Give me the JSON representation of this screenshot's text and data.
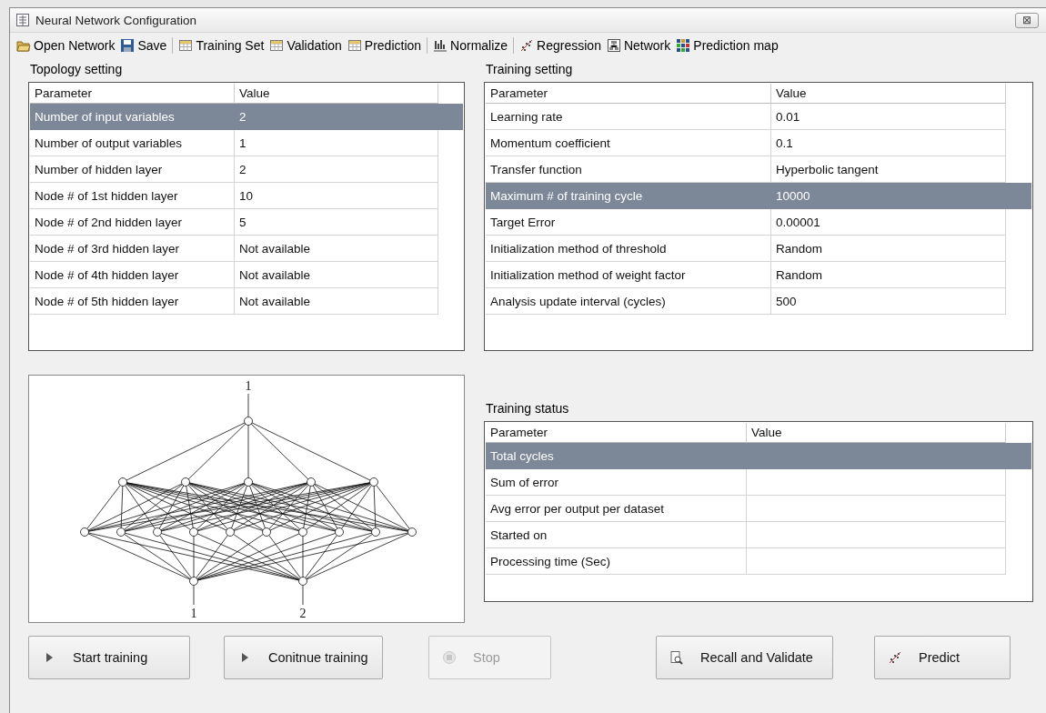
{
  "window": {
    "title": "Neural Network Configuration",
    "close": "⊠"
  },
  "toolbar": {
    "groups": [
      [
        {
          "label": "Open Network",
          "kind": "folder"
        },
        {
          "label": "Save",
          "kind": "disk"
        }
      ],
      [
        {
          "label": "Training Set",
          "kind": "grid"
        },
        {
          "label": "Validation",
          "kind": "grid"
        },
        {
          "label": "Prediction",
          "kind": "grid"
        }
      ],
      [
        {
          "label": "Normalize",
          "kind": "bars"
        }
      ],
      [
        {
          "label": "Regression",
          "kind": "scatter"
        },
        {
          "label": "Network",
          "kind": "network"
        },
        {
          "label": "Prediction map",
          "kind": "tiles"
        }
      ]
    ]
  },
  "topology": {
    "title": "Topology setting",
    "columns": [
      "Parameter",
      "Value"
    ],
    "rows": [
      {
        "cells": [
          "Number of input variables",
          "2"
        ],
        "selected": true
      },
      {
        "cells": [
          "Number of output variables",
          "1"
        ],
        "selected": false
      },
      {
        "cells": [
          "Number of hidden layer",
          "2"
        ],
        "selected": false
      },
      {
        "cells": [
          "Node # of 1st hidden layer",
          "10"
        ],
        "selected": false
      },
      {
        "cells": [
          "Node # of 2nd hidden layer",
          "5"
        ],
        "selected": false
      },
      {
        "cells": [
          "Node # of 3rd hidden layer",
          "Not available"
        ],
        "selected": false
      },
      {
        "cells": [
          "Node # of 4th hidden layer",
          "Not available"
        ],
        "selected": false
      },
      {
        "cells": [
          "Node # of 5th hidden layer",
          "Not available"
        ],
        "selected": false
      }
    ]
  },
  "training": {
    "title": "Training setting",
    "columns": [
      "Parameter",
      "Value"
    ],
    "rows": [
      {
        "cells": [
          "Learning rate",
          "0.01"
        ],
        "selected": false
      },
      {
        "cells": [
          "Momentum coefficient",
          "0.1"
        ],
        "selected": false
      },
      {
        "cells": [
          "Transfer function",
          "Hyperbolic tangent"
        ],
        "selected": false
      },
      {
        "cells": [
          "Maximum # of training cycle",
          "10000"
        ],
        "selected": true
      },
      {
        "cells": [
          "Target Error",
          "0.00001"
        ],
        "selected": false
      },
      {
        "cells": [
          "Initialization method of threshold",
          "Random"
        ],
        "selected": false
      },
      {
        "cells": [
          "Initialization method of weight factor",
          "Random"
        ],
        "selected": false
      },
      {
        "cells": [
          "Analysis update interval (cycles)",
          "500"
        ],
        "selected": false
      }
    ]
  },
  "diagram": {
    "output_labels": [
      "1"
    ],
    "input_labels": [
      "1",
      "2"
    ]
  },
  "status": {
    "title": "Training status",
    "columns": [
      "Parameter",
      "Value"
    ],
    "rows": [
      {
        "cells": [
          "Total cycles"
        ],
        "selected": true
      },
      {
        "cells": [
          "Sum of error"
        ],
        "selected": false
      },
      {
        "cells": [
          "Avg error per output per dataset"
        ],
        "selected": false
      },
      {
        "cells": [
          "Started on"
        ],
        "selected": false
      },
      {
        "cells": [
          "Processing time (Sec)"
        ],
        "selected": false
      }
    ]
  },
  "buttons": [
    {
      "label": "Start training",
      "kind": "play",
      "disabled": false
    },
    {
      "label": "Conitnue training",
      "kind": "play",
      "disabled": false
    },
    {
      "label": "Stop",
      "kind": "stop",
      "disabled": true
    },
    {
      "label": "Recall and Validate",
      "kind": "magnifier",
      "disabled": false
    },
    {
      "label": "Predict",
      "kind": "scatter",
      "disabled": false
    }
  ]
}
